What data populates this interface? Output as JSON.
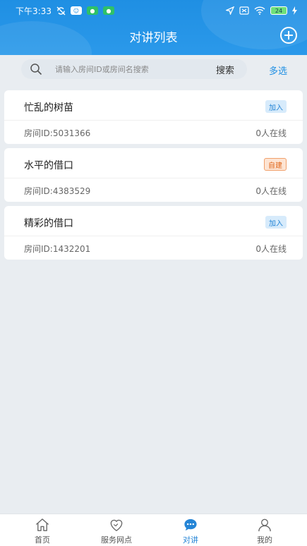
{
  "status_bar": {
    "time": "下午3:33",
    "battery": "24"
  },
  "header": {
    "title": "对讲列表",
    "add_icon": "plus-circle-icon"
  },
  "search": {
    "placeholder": "请输入房间ID或房间名搜索",
    "button_label": "搜索",
    "multi_select_label": "多选"
  },
  "rooms": [
    {
      "name": "忙乱的树苗",
      "badge": "加入",
      "badge_type": "join",
      "id_text": "房间ID:5031366",
      "online_text": "0人在线"
    },
    {
      "name": "水平的借口",
      "badge": "自建",
      "badge_type": "own",
      "id_text": "房间ID:4383529",
      "online_text": "0人在线"
    },
    {
      "name": "精彩的借口",
      "badge": "加入",
      "badge_type": "join",
      "id_text": "房间ID:1432201",
      "online_text": "0人在线"
    }
  ],
  "tabs": [
    {
      "label": "首页",
      "icon": "home-icon",
      "active": false
    },
    {
      "label": "服务网点",
      "icon": "heart-icon",
      "active": false
    },
    {
      "label": "对讲",
      "icon": "chat-icon",
      "active": true
    },
    {
      "label": "我的",
      "icon": "user-icon",
      "active": false
    }
  ],
  "colors": {
    "brand": "#1f8fe3",
    "join_badge": "#2585d6",
    "own_badge": "#e0661a"
  }
}
